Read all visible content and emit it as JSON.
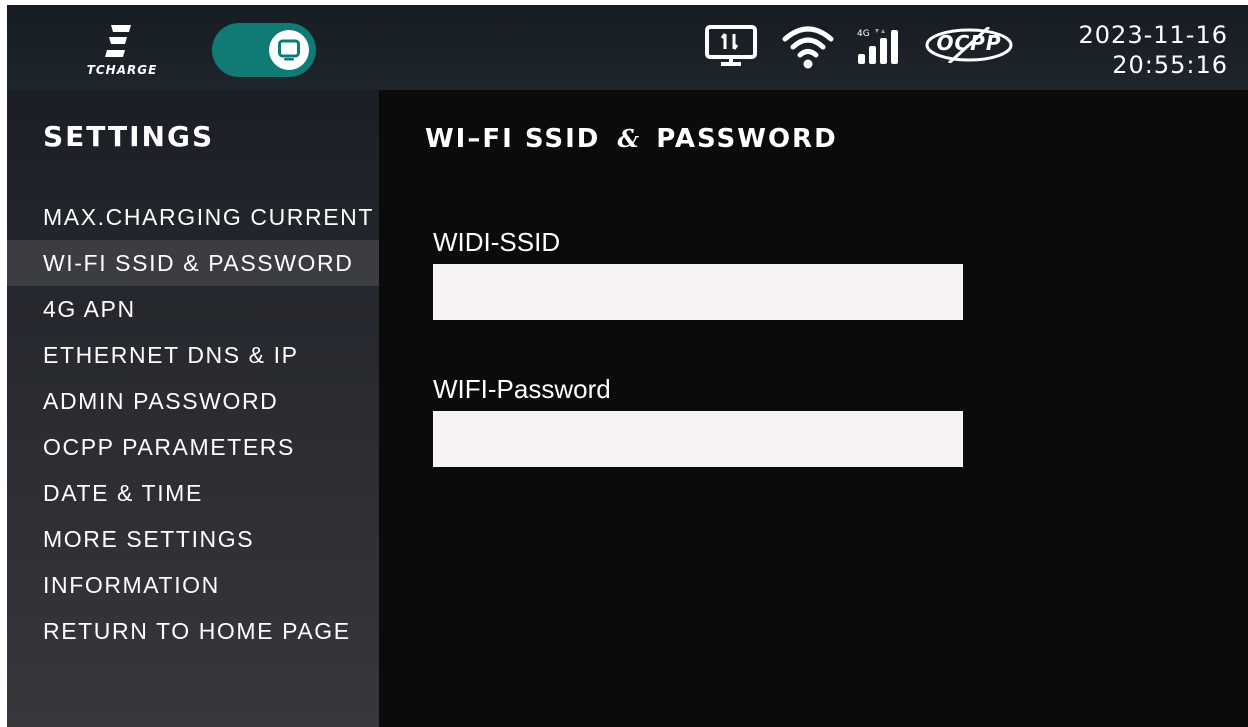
{
  "header": {
    "brand_name": "TCHARGE",
    "network_badge": "4G",
    "ocpp_label": "OCPP",
    "date": "2023-11-16",
    "time": "20:55:16",
    "toggle_on": true,
    "accent_color": "#0f7b74",
    "icons": [
      "tcharge-logo-icon",
      "screen-toggle-icon",
      "ethernet-icon",
      "wifi-icon",
      "signal-4g-icon",
      "ocpp-disabled-icon"
    ]
  },
  "sidebar": {
    "title": "SETTINGS",
    "items": [
      {
        "label": "MAX.CHARGING CURRENT",
        "active": false
      },
      {
        "label": "WI-FI SSID & PASSWORD",
        "active": true
      },
      {
        "label": "4G APN",
        "active": false
      },
      {
        "label": "ETHERNET DNS & IP",
        "active": false
      },
      {
        "label": "ADMIN PASSWORD",
        "active": false
      },
      {
        "label": "OCPP PARAMETERS",
        "active": false
      },
      {
        "label": "DATE & TIME",
        "active": false
      },
      {
        "label": "MORE SETTINGS",
        "active": false
      },
      {
        "label": "INFORMATION",
        "active": false
      },
      {
        "label": "RETURN TO HOME PAGE",
        "active": false
      }
    ]
  },
  "main": {
    "title_left": "WI–FI SSID",
    "title_amp": "&",
    "title_right": "PASSWORD",
    "fields": [
      {
        "label": "WIDI-SSID",
        "value": ""
      },
      {
        "label": "WIFI-Password",
        "value": ""
      }
    ]
  }
}
